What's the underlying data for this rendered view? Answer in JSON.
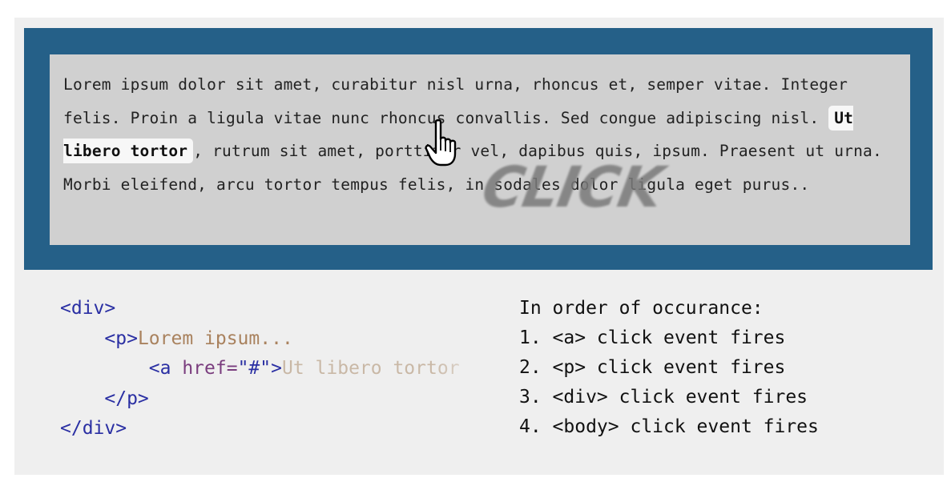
{
  "paragraph": {
    "before_link": "Lorem ipsum dolor sit amet, curabitur nisl urna, rhoncus et, semper vitae. Integer felis. Proin a ligula vitae nunc rhoncus convallis. Sed congue adipiscing nisl. ",
    "link_text": "Ut libero tortor",
    "after_link": ", rutrum sit amet, porttitor vel, dapibus quis, ipsum. Praesent ut urna. Morbi eleifend, arcu tortor tempus felis, in sodales dolor ligula eget purus.."
  },
  "click_label": "CLICK",
  "code": {
    "div_open": "<div>",
    "p_open": "<p>",
    "p_text": "Lorem ipsum...",
    "a_open_start": "<a ",
    "a_attr": "href=",
    "a_value": "\"#\"",
    "a_open_end": ">",
    "a_text": "Ut libero tortor",
    "p_close": "</p>",
    "div_close": "</div>"
  },
  "occurrence": {
    "title": "In order of occurance:",
    "items": [
      "1. <a> click event fires",
      "2. <p> click event fires",
      "3. <div> click event fires",
      "4. <body> click event fires"
    ]
  },
  "colors": {
    "panel": "#256088",
    "text_box": "#d0d0d0",
    "tag": "#2a2fa3",
    "attribute": "#7a3d7e",
    "text_content": "#a9825e"
  },
  "icons": [
    "hand-pointer-icon"
  ]
}
